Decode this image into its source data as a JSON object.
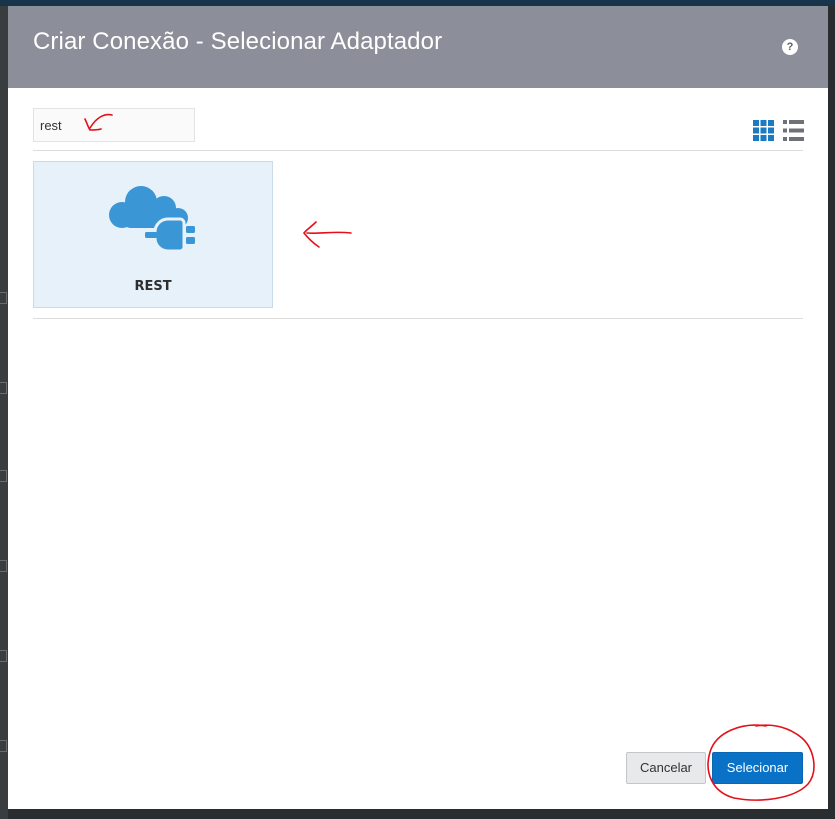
{
  "dialog": {
    "title": "Criar Conexão - Selecionar Adaptador",
    "help_label": "?"
  },
  "search": {
    "value": "rest",
    "placeholder": ""
  },
  "view_toggle": {
    "grid_icon": "grid-view-icon",
    "list_icon": "list-view-icon",
    "active": "grid",
    "active_color": "#1a7ac4",
    "inactive_color": "#6e7177"
  },
  "adapters": [
    {
      "label": "REST",
      "icon": "cloud-plug-icon",
      "selected": true
    }
  ],
  "footer": {
    "cancel_label": "Cancelar",
    "select_label": "Selecionar"
  },
  "colors": {
    "header_bg": "#8c8f99",
    "tile_bg": "#e6f1fa",
    "icon_blue": "#3b96d6",
    "primary_button": "#0a72c6",
    "annotation_red": "#e3101a"
  }
}
